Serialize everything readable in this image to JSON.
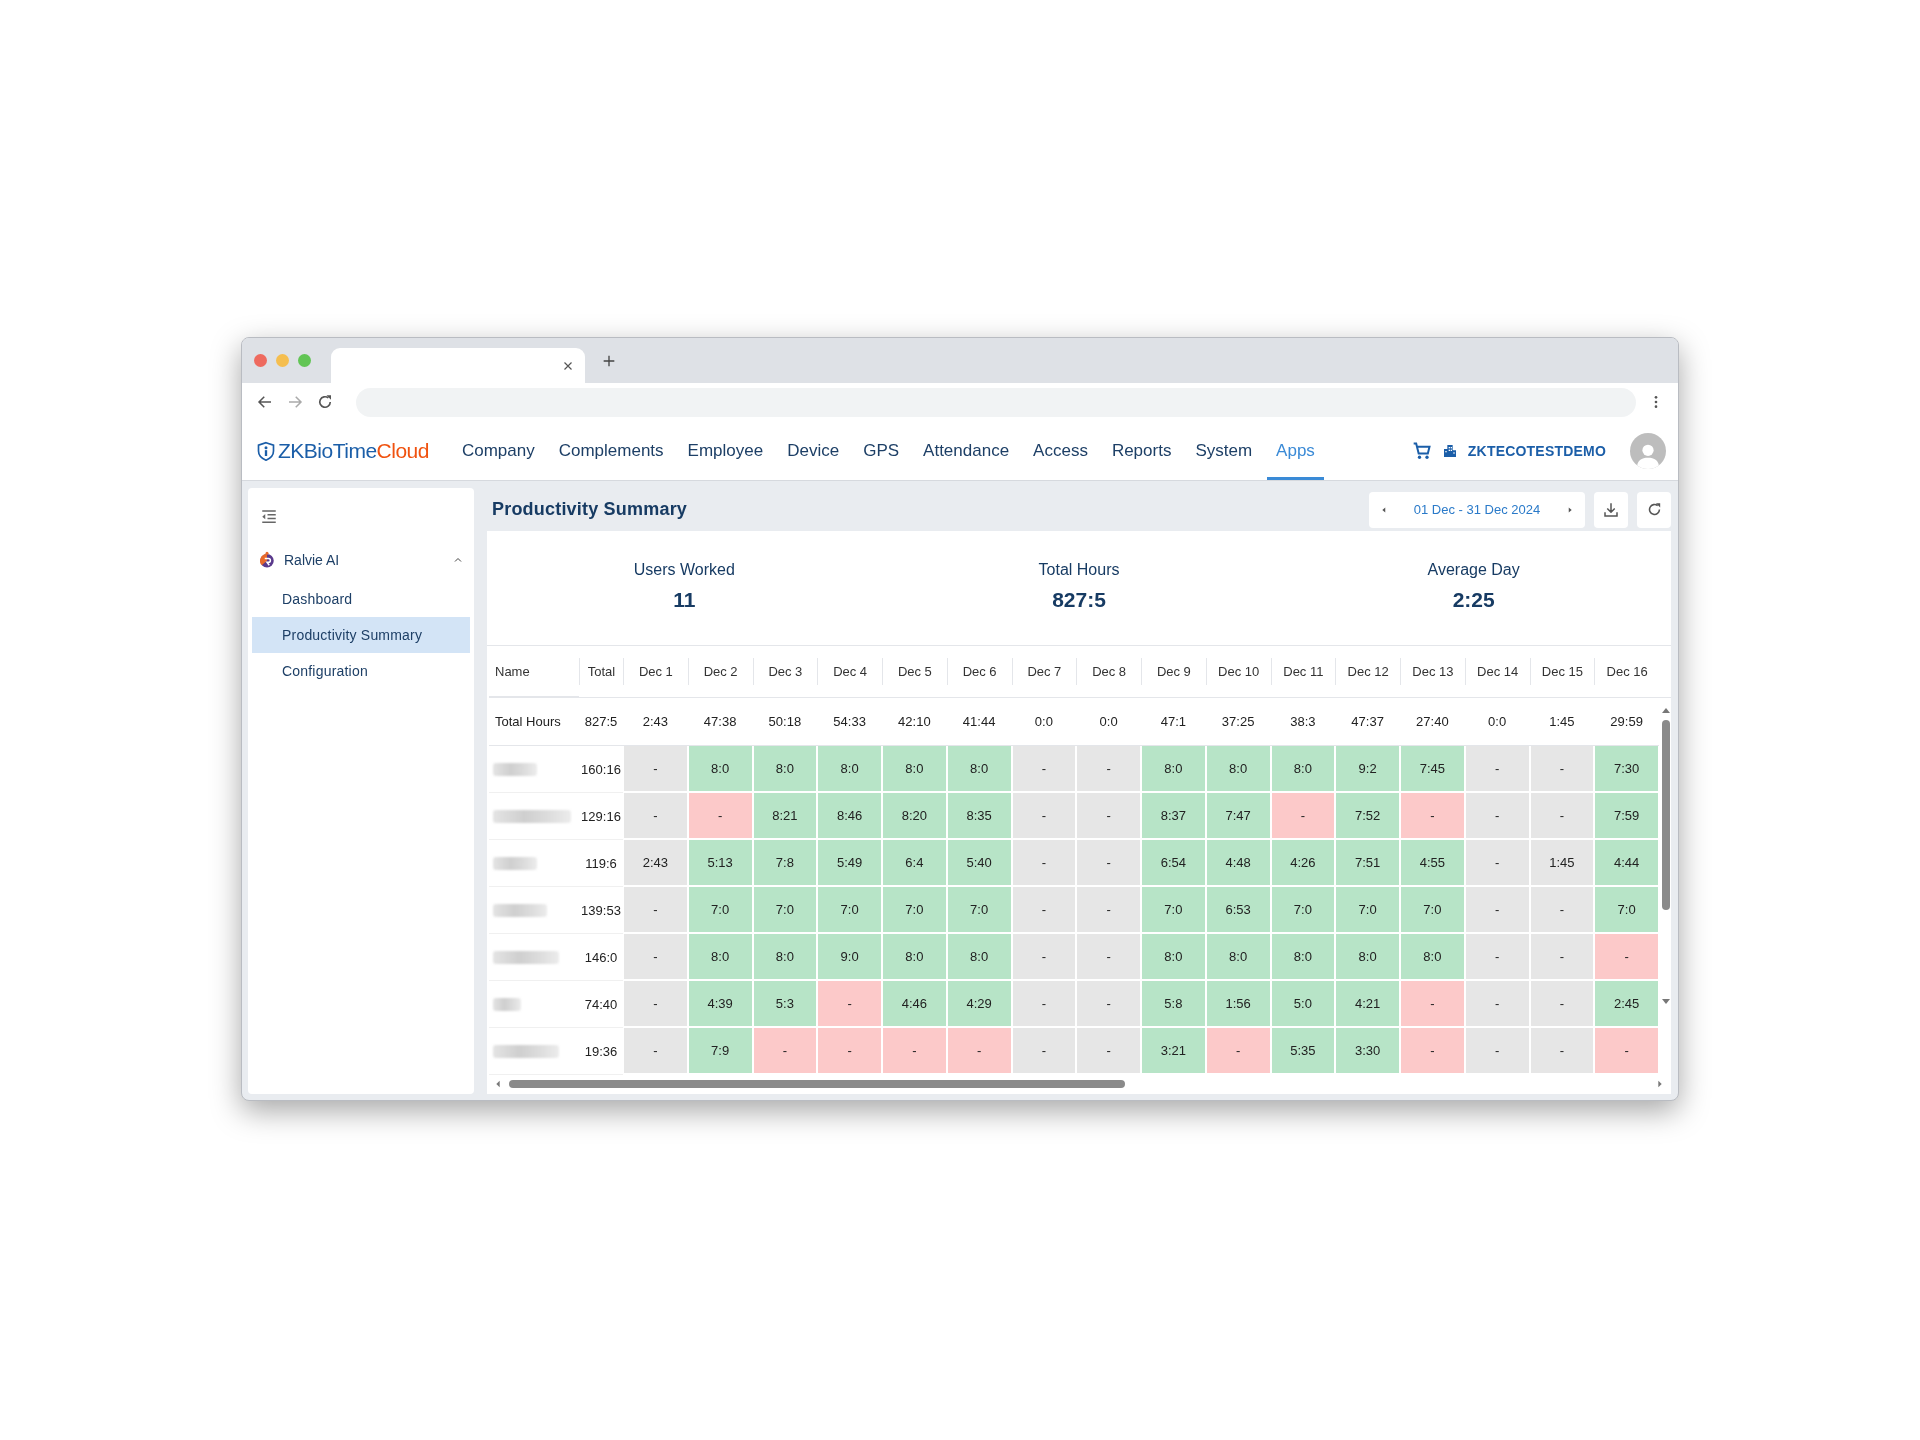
{
  "header": {
    "logo": {
      "primary": "ZKBioTime",
      "accent": "Cloud"
    },
    "nav": [
      {
        "label": "Company",
        "selected": false
      },
      {
        "label": "Complements",
        "selected": false
      },
      {
        "label": "Employee",
        "selected": false
      },
      {
        "label": "Device",
        "selected": false
      },
      {
        "label": "GPS",
        "selected": false
      },
      {
        "label": "Attendance",
        "selected": false
      },
      {
        "label": "Access",
        "selected": false
      },
      {
        "label": "Reports",
        "selected": false
      },
      {
        "label": "System",
        "selected": false
      },
      {
        "label": "Apps",
        "selected": true
      }
    ],
    "account": "ZKTECOTESTDEMO"
  },
  "sidebar": {
    "app": {
      "label": "Ralvie AI",
      "expanded": true
    },
    "items": [
      {
        "label": "Dashboard",
        "selected": false
      },
      {
        "label": "Productivity Summary",
        "selected": true
      },
      {
        "label": "Configuration",
        "selected": false
      }
    ]
  },
  "page": {
    "title": "Productivity Summary",
    "date_range": "01 Dec - 31 Dec 2024"
  },
  "stats": [
    {
      "label": "Users Worked",
      "value": "11"
    },
    {
      "label": "Total Hours",
      "value": "827:5"
    },
    {
      "label": "Average Day",
      "value": "2:25"
    }
  ],
  "table": {
    "columns": [
      "Name",
      "Total",
      "Dec 1",
      "Dec 2",
      "Dec 3",
      "Dec 4",
      "Dec 5",
      "Dec 6",
      "Dec 7",
      "Dec 8",
      "Dec 9",
      "Dec 10",
      "Dec 11",
      "Dec 12",
      "Dec 13",
      "Dec 14",
      "Dec 15",
      "Dec 16"
    ],
    "totals": {
      "label": "Total Hours",
      "total": "827:5",
      "days": [
        "2:43",
        "47:38",
        "50:18",
        "54:33",
        "42:10",
        "41:44",
        "0:0",
        "0:0",
        "47:1",
        "37:25",
        "38:3",
        "47:37",
        "27:40",
        "0:0",
        "1:45",
        "29:59"
      ]
    },
    "rows": [
      {
        "total": "160:16",
        "days": [
          {
            "value": "-",
            "color": "#e6e6e6"
          },
          {
            "value": "8:0",
            "color": "#b7e4c7"
          },
          {
            "value": "8:0",
            "color": "#b7e4c7"
          },
          {
            "value": "8:0",
            "color": "#b7e4c7"
          },
          {
            "value": "8:0",
            "color": "#b7e4c7"
          },
          {
            "value": "8:0",
            "color": "#b7e4c7"
          },
          {
            "value": "-",
            "color": "#e6e6e6"
          },
          {
            "value": "-",
            "color": "#e6e6e6"
          },
          {
            "value": "8:0",
            "color": "#b7e4c7"
          },
          {
            "value": "8:0",
            "color": "#b7e4c7"
          },
          {
            "value": "8:0",
            "color": "#b7e4c7"
          },
          {
            "value": "9:2",
            "color": "#b7e4c7"
          },
          {
            "value": "7:45",
            "color": "#b7e4c7"
          },
          {
            "value": "-",
            "color": "#e6e6e6"
          },
          {
            "value": "-",
            "color": "#e6e6e6"
          },
          {
            "value": "7:30",
            "color": "#b7e4c7"
          }
        ]
      },
      {
        "total": "129:16",
        "days": [
          {
            "value": "-",
            "color": "#e6e6e6"
          },
          {
            "value": "-",
            "color": "#fcc9c9"
          },
          {
            "value": "8:21",
            "color": "#b7e4c7"
          },
          {
            "value": "8:46",
            "color": "#b7e4c7"
          },
          {
            "value": "8:20",
            "color": "#b7e4c7"
          },
          {
            "value": "8:35",
            "color": "#b7e4c7"
          },
          {
            "value": "-",
            "color": "#e6e6e6"
          },
          {
            "value": "-",
            "color": "#e6e6e6"
          },
          {
            "value": "8:37",
            "color": "#b7e4c7"
          },
          {
            "value": "7:47",
            "color": "#b7e4c7"
          },
          {
            "value": "-",
            "color": "#fcc9c9"
          },
          {
            "value": "7:52",
            "color": "#b7e4c7"
          },
          {
            "value": "-",
            "color": "#fcc9c9"
          },
          {
            "value": "-",
            "color": "#e6e6e6"
          },
          {
            "value": "-",
            "color": "#e6e6e6"
          },
          {
            "value": "7:59",
            "color": "#b7e4c7"
          }
        ]
      },
      {
        "total": "119:6",
        "days": [
          {
            "value": "2:43",
            "color": "#e6e6e6"
          },
          {
            "value": "5:13",
            "color": "#b7e4c7"
          },
          {
            "value": "7:8",
            "color": "#b7e4c7"
          },
          {
            "value": "5:49",
            "color": "#b7e4c7"
          },
          {
            "value": "6:4",
            "color": "#b7e4c7"
          },
          {
            "value": "5:40",
            "color": "#b7e4c7"
          },
          {
            "value": "-",
            "color": "#e6e6e6"
          },
          {
            "value": "-",
            "color": "#e6e6e6"
          },
          {
            "value": "6:54",
            "color": "#b7e4c7"
          },
          {
            "value": "4:48",
            "color": "#b7e4c7"
          },
          {
            "value": "4:26",
            "color": "#b7e4c7"
          },
          {
            "value": "7:51",
            "color": "#b7e4c7"
          },
          {
            "value": "4:55",
            "color": "#b7e4c7"
          },
          {
            "value": "-",
            "color": "#e6e6e6"
          },
          {
            "value": "1:45",
            "color": "#e6e6e6"
          },
          {
            "value": "4:44",
            "color": "#b7e4c7"
          }
        ]
      },
      {
        "total": "139:53",
        "days": [
          {
            "value": "-",
            "color": "#e6e6e6"
          },
          {
            "value": "7:0",
            "color": "#b7e4c7"
          },
          {
            "value": "7:0",
            "color": "#b7e4c7"
          },
          {
            "value": "7:0",
            "color": "#b7e4c7"
          },
          {
            "value": "7:0",
            "color": "#b7e4c7"
          },
          {
            "value": "7:0",
            "color": "#b7e4c7"
          },
          {
            "value": "-",
            "color": "#e6e6e6"
          },
          {
            "value": "-",
            "color": "#e6e6e6"
          },
          {
            "value": "7:0",
            "color": "#b7e4c7"
          },
          {
            "value": "6:53",
            "color": "#b7e4c7"
          },
          {
            "value": "7:0",
            "color": "#b7e4c7"
          },
          {
            "value": "7:0",
            "color": "#b7e4c7"
          },
          {
            "value": "7:0",
            "color": "#b7e4c7"
          },
          {
            "value": "-",
            "color": "#e6e6e6"
          },
          {
            "value": "-",
            "color": "#e6e6e6"
          },
          {
            "value": "7:0",
            "color": "#b7e4c7"
          }
        ]
      },
      {
        "total": "146:0",
        "days": [
          {
            "value": "-",
            "color": "#e6e6e6"
          },
          {
            "value": "8:0",
            "color": "#b7e4c7"
          },
          {
            "value": "8:0",
            "color": "#b7e4c7"
          },
          {
            "value": "9:0",
            "color": "#b7e4c7"
          },
          {
            "value": "8:0",
            "color": "#b7e4c7"
          },
          {
            "value": "8:0",
            "color": "#b7e4c7"
          },
          {
            "value": "-",
            "color": "#e6e6e6"
          },
          {
            "value": "-",
            "color": "#e6e6e6"
          },
          {
            "value": "8:0",
            "color": "#b7e4c7"
          },
          {
            "value": "8:0",
            "color": "#b7e4c7"
          },
          {
            "value": "8:0",
            "color": "#b7e4c7"
          },
          {
            "value": "8:0",
            "color": "#b7e4c7"
          },
          {
            "value": "8:0",
            "color": "#b7e4c7"
          },
          {
            "value": "-",
            "color": "#e6e6e6"
          },
          {
            "value": "-",
            "color": "#e6e6e6"
          },
          {
            "value": "-",
            "color": "#fcc9c9"
          }
        ]
      },
      {
        "total": "74:40",
        "days": [
          {
            "value": "-",
            "color": "#e6e6e6"
          },
          {
            "value": "4:39",
            "color": "#b7e4c7"
          },
          {
            "value": "5:3",
            "color": "#b7e4c7"
          },
          {
            "value": "-",
            "color": "#fcc9c9"
          },
          {
            "value": "4:46",
            "color": "#b7e4c7"
          },
          {
            "value": "4:29",
            "color": "#b7e4c7"
          },
          {
            "value": "-",
            "color": "#e6e6e6"
          },
          {
            "value": "-",
            "color": "#e6e6e6"
          },
          {
            "value": "5:8",
            "color": "#b7e4c7"
          },
          {
            "value": "1:56",
            "color": "#b7e4c7"
          },
          {
            "value": "5:0",
            "color": "#b7e4c7"
          },
          {
            "value": "4:21",
            "color": "#b7e4c7"
          },
          {
            "value": "-",
            "color": "#fcc9c9"
          },
          {
            "value": "-",
            "color": "#e6e6e6"
          },
          {
            "value": "-",
            "color": "#e6e6e6"
          },
          {
            "value": "2:45",
            "color": "#b7e4c7"
          }
        ]
      },
      {
        "total": "19:36",
        "days": [
          {
            "value": "-",
            "color": "#e6e6e6"
          },
          {
            "value": "7:9",
            "color": "#b7e4c7"
          },
          {
            "value": "-",
            "color": "#fcc9c9"
          },
          {
            "value": "-",
            "color": "#fcc9c9"
          },
          {
            "value": "-",
            "color": "#fcc9c9"
          },
          {
            "value": "-",
            "color": "#fcc9c9"
          },
          {
            "value": "-",
            "color": "#e6e6e6"
          },
          {
            "value": "-",
            "color": "#e6e6e6"
          },
          {
            "value": "3:21",
            "color": "#b7e4c7"
          },
          {
            "value": "-",
            "color": "#fcc9c9"
          },
          {
            "value": "5:35",
            "color": "#b7e4c7"
          },
          {
            "value": "3:30",
            "color": "#b7e4c7"
          },
          {
            "value": "-",
            "color": "#fcc9c9"
          },
          {
            "value": "-",
            "color": "#e6e6e6"
          },
          {
            "value": "-",
            "color": "#e6e6e6"
          },
          {
            "value": "-",
            "color": "#fcc9c9"
          }
        ]
      }
    ]
  }
}
